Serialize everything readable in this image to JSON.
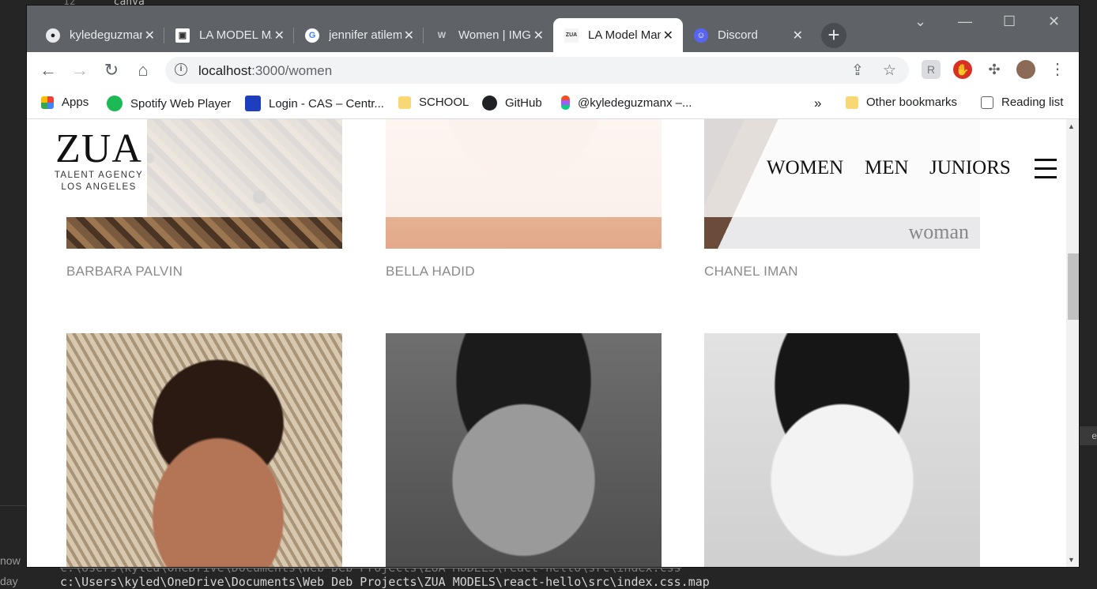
{
  "background": {
    "editor_line_number": "12",
    "editor_line_text": "canva",
    "left_texts": [
      "now",
      "day"
    ],
    "right_strip_text": "e",
    "terminal_line_prev": "c:\\Users\\kyled\\OneDrive\\Documents\\Web Deb Projects\\ZUA MODELS\\react-hello\\src\\index.css",
    "terminal_line": "c:\\Users\\kyled\\OneDrive\\Documents\\Web Deb Projects\\ZUA MODELS\\react-hello\\src\\index.css.map"
  },
  "tabs": [
    {
      "title": "kyledeguzmanx",
      "icon": "github-icon",
      "active": false
    },
    {
      "title": "LA MODEL MANAGEMENT",
      "icon": "site-logo-icon",
      "active": false
    },
    {
      "title": "jennifer atilemile",
      "icon": "google-icon",
      "active": false
    },
    {
      "title": "Women | IMG Models",
      "icon": "wix-icon",
      "active": false
    },
    {
      "title": "LA Model Management",
      "icon": "zua-icon",
      "active": true
    },
    {
      "title": "Discord",
      "icon": "discord-icon",
      "active": false
    }
  ],
  "toolbar": {
    "url_host": "localhost",
    "url_path": ":3000/women"
  },
  "bookmarks": [
    {
      "label": "Apps",
      "icon": "apps-grid-icon"
    },
    {
      "label": "Spotify Web Player",
      "icon": "spotify-icon"
    },
    {
      "label": "Login - CAS – Centr...",
      "icon": "cas-icon"
    },
    {
      "label": "SCHOOL",
      "icon": "folder-icon"
    },
    {
      "label": "GitHub",
      "icon": "github-icon"
    },
    {
      "label": "@kyledeguzmanx –...",
      "icon": "figma-icon"
    },
    {
      "label": "»",
      "icon": ""
    },
    {
      "label": "Other bookmarks",
      "icon": "folder-icon"
    },
    {
      "label": "Reading list",
      "icon": "reading-list-icon"
    }
  ],
  "page": {
    "logo": {
      "title": "ZUA",
      "line1": "TALENT AGENCY",
      "line2": "LOS ANGELES"
    },
    "nav": [
      "WOMEN",
      "MEN",
      "JUNIORS"
    ],
    "models_row1": [
      "BARBARA PALVIN",
      "BELLA HADID",
      "CHANEL IMAN"
    ],
    "photo_watermark": "woman"
  },
  "colors": {
    "tabstrip": "#5f6368",
    "model_name": "#8a8a8a"
  }
}
